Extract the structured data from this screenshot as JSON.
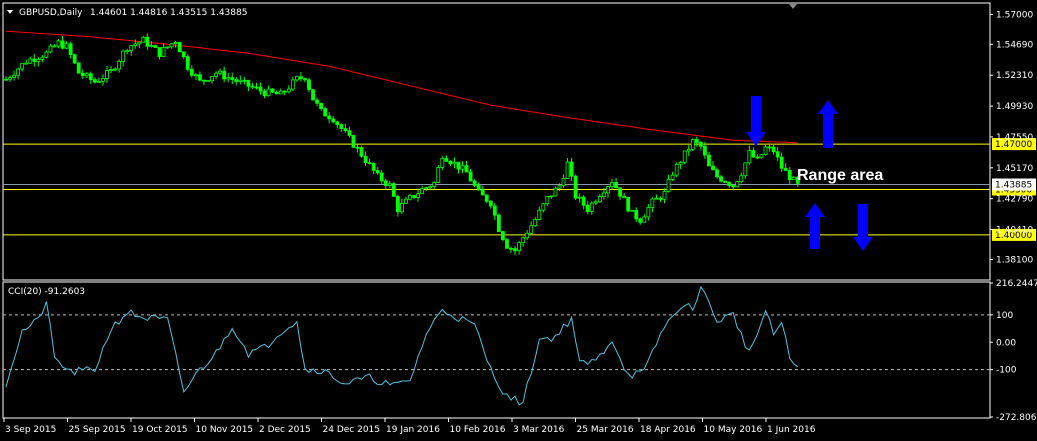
{
  "header": {
    "symbol": "GBPUSD,Daily",
    "ohlc": "1.44601 1.44816 1.43515 1.43885",
    "cci_title": "CCI(20) -91.2603"
  },
  "colors": {
    "background": "#000000",
    "frame": "#ffffff",
    "bull_candle": "#00ff00",
    "ma_line": "#ff0000",
    "level_line": "#ffff00",
    "cci_line": "#4fc3e0",
    "arrow": "#0000ff",
    "annotation_text": "#ffffff"
  },
  "chart_data": [
    {
      "type": "candlestick",
      "title": "GBPUSD,Daily",
      "ylim": [
        1.366,
        1.578
      ],
      "y_ticks": [
        "1.57000",
        "1.54690",
        "1.52310",
        "1.49930",
        "1.47550",
        "1.45170",
        "1.42790",
        "1.40410",
        "1.38100"
      ],
      "x_ticks": [
        "3 Sep 2015",
        "25 Sep 2015",
        "19 Oct 2015",
        "10 Nov 2015",
        "2 Dec 2015",
        "24 Dec 2015",
        "19 Jan 2016",
        "10 Feb 2016",
        "3 Mar 2016",
        "25 Mar 2016",
        "18 Apr 2016",
        "10 May 2016",
        "1 Jun 2016"
      ],
      "close_anchors": [
        [
          0,
          1.52
        ],
        [
          5,
          1.534
        ],
        [
          10,
          1.54
        ],
        [
          13,
          1.548
        ],
        [
          15,
          1.545
        ],
        [
          18,
          1.525
        ],
        [
          22,
          1.518
        ],
        [
          26,
          1.526
        ],
        [
          30,
          1.545
        ],
        [
          34,
          1.55
        ],
        [
          38,
          1.54
        ],
        [
          42,
          1.55
        ],
        [
          45,
          1.53
        ],
        [
          48,
          1.518
        ],
        [
          52,
          1.525
        ],
        [
          56,
          1.52
        ],
        [
          60,
          1.515
        ],
        [
          64,
          1.51
        ],
        [
          68,
          1.508
        ],
        [
          72,
          1.52
        ],
        [
          74,
          1.522
        ],
        [
          76,
          1.505
        ],
        [
          78,
          1.495
        ],
        [
          81,
          1.49
        ],
        [
          84,
          1.478
        ],
        [
          88,
          1.462
        ],
        [
          92,
          1.445
        ],
        [
          95,
          1.438
        ],
        [
          97,
          1.42
        ],
        [
          100,
          1.428
        ],
        [
          103,
          1.435
        ],
        [
          106,
          1.44
        ],
        [
          108,
          1.462
        ],
        [
          111,
          1.455
        ],
        [
          114,
          1.448
        ],
        [
          117,
          1.432
        ],
        [
          120,
          1.425
        ],
        [
          122,
          1.405
        ],
        [
          124,
          1.392
        ],
        [
          126,
          1.388
        ],
        [
          128,
          1.398
        ],
        [
          131,
          1.412
        ],
        [
          134,
          1.428
        ],
        [
          137,
          1.438
        ],
        [
          139,
          1.455
        ],
        [
          141,
          1.43
        ],
        [
          144,
          1.42
        ],
        [
          147,
          1.432
        ],
        [
          150,
          1.442
        ],
        [
          152,
          1.432
        ],
        [
          155,
          1.416
        ],
        [
          157,
          1.412
        ],
        [
          160,
          1.425
        ],
        [
          163,
          1.432
        ],
        [
          165,
          1.448
        ],
        [
          168,
          1.462
        ],
        [
          170,
          1.472
        ],
        [
          172,
          1.468
        ],
        [
          174,
          1.452
        ],
        [
          176,
          1.445
        ],
        [
          178,
          1.442
        ],
        [
          180,
          1.438
        ],
        [
          182,
          1.448
        ],
        [
          184,
          1.463
        ],
        [
          186,
          1.457
        ],
        [
          188,
          1.467
        ],
        [
          190,
          1.465
        ],
        [
          192,
          1.452
        ],
        [
          194,
          1.445
        ],
        [
          196,
          1.438
        ]
      ],
      "ma_anchors": [
        [
          0,
          1.557
        ],
        [
          20,
          1.553
        ],
        [
          40,
          1.547
        ],
        [
          60,
          1.54
        ],
        [
          80,
          1.53
        ],
        [
          100,
          1.515
        ],
        [
          120,
          1.5
        ],
        [
          140,
          1.49
        ],
        [
          160,
          1.481
        ],
        [
          180,
          1.473
        ],
        [
          196,
          1.471
        ]
      ],
      "levels": [
        1.47,
        1.435,
        1.4
      ],
      "level_labels": [
        "1.47000",
        "1.43500",
        "1.40000"
      ],
      "current_price_label": "1.43885",
      "annotation": "Range area"
    },
    {
      "type": "line",
      "title": "CCI(20) -91.2603",
      "ylim": [
        -272.8061,
        216.2447
      ],
      "y_ticks": [
        "216.2447",
        "100",
        "0.00",
        "-100",
        "-272.8061"
      ],
      "reference_levels": [
        100,
        -100
      ],
      "series_anchors": [
        [
          0,
          -150
        ],
        [
          4,
          40
        ],
        [
          8,
          80
        ],
        [
          10,
          150
        ],
        [
          12,
          -60
        ],
        [
          16,
          -110
        ],
        [
          22,
          -100
        ],
        [
          26,
          50
        ],
        [
          30,
          110
        ],
        [
          34,
          90
        ],
        [
          40,
          80
        ],
        [
          44,
          -180
        ],
        [
          48,
          -100
        ],
        [
          52,
          -40
        ],
        [
          56,
          60
        ],
        [
          60,
          -40
        ],
        [
          64,
          -20
        ],
        [
          68,
          40
        ],
        [
          72,
          80
        ],
        [
          74,
          -100
        ],
        [
          78,
          -100
        ],
        [
          84,
          -150
        ],
        [
          90,
          -130
        ],
        [
          96,
          -160
        ],
        [
          100,
          -140
        ],
        [
          104,
          30
        ],
        [
          108,
          120
        ],
        [
          112,
          90
        ],
        [
          116,
          60
        ],
        [
          120,
          -100
        ],
        [
          124,
          -200
        ],
        [
          128,
          -220
        ],
        [
          132,
          10
        ],
        [
          136,
          20
        ],
        [
          140,
          90
        ],
        [
          142,
          -80
        ],
        [
          146,
          -70
        ],
        [
          150,
          10
        ],
        [
          154,
          -120
        ],
        [
          158,
          -110
        ],
        [
          162,
          30
        ],
        [
          166,
          120
        ],
        [
          170,
          130
        ],
        [
          172,
          200
        ],
        [
          176,
          80
        ],
        [
          180,
          100
        ],
        [
          184,
          -40
        ],
        [
          188,
          110
        ],
        [
          190,
          30
        ],
        [
          192,
          70
        ],
        [
          194,
          -60
        ],
        [
          196,
          -91
        ]
      ]
    }
  ]
}
